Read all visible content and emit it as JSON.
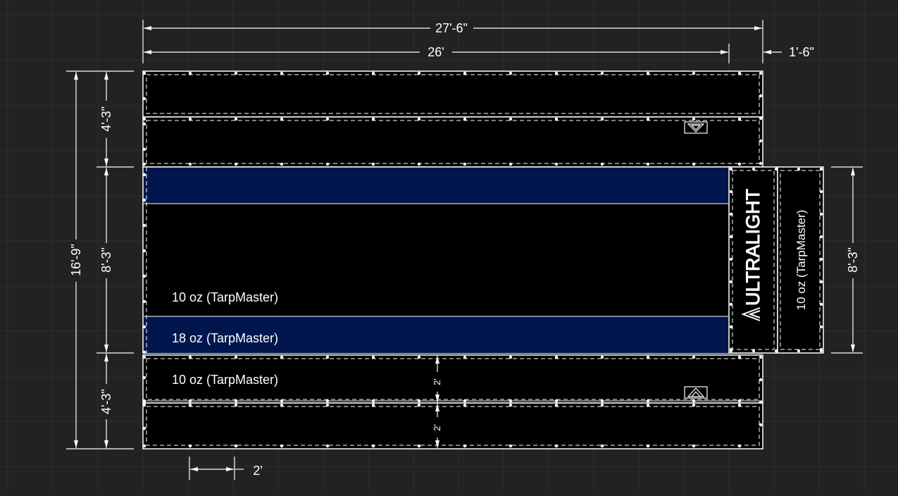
{
  "colors": {
    "background": "#222222",
    "grid_line": "#333333",
    "tarp_black": "#000000",
    "tarp_navy": "#00164d",
    "line": "#ffffff",
    "grommet": "#ffffff"
  },
  "dimensions": {
    "overall_width": "27'-6\"",
    "main_width": "26'",
    "flap_width": "1'-6\"",
    "overall_height": "16'-9\"",
    "top_section": "4'-3\"",
    "middle_section": "8'-3\"",
    "bottom_section": "4'-3\"",
    "right_panel_height": "8'-3\"",
    "strip_upper": "2'",
    "strip_lower": "2'",
    "grommet_spacing": "2'"
  },
  "labels": {
    "middle_material": "10 oz (TarpMaster)",
    "stripe_material": "18 oz (TarpMaster)",
    "bottom_material": "10 oz (TarpMaster)",
    "side_material": "10 oz (TarpMaster)",
    "brand": "ULTRALIGHT"
  },
  "icons": {
    "logo_top": "ultralight-logo-icon",
    "logo_bottom": "ultralight-logo-icon",
    "brand_mark": "ultralight-logo-icon"
  }
}
